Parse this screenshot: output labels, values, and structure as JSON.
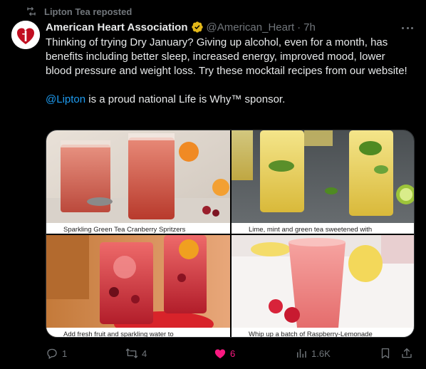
{
  "repost": {
    "text": "Lipton Tea reposted",
    "icon": "repost-icon"
  },
  "author": {
    "name": "American Heart Association",
    "handle": "@American_Heart",
    "separator": "·",
    "time": "7h",
    "verified_color": "#e2b719",
    "avatar_icon": "aha-heart-torch-logo",
    "avatar_color": "#c10e21"
  },
  "tweet": {
    "text": "Thinking of trying Dry January? Giving up alcohol, even for a month, has benefits including better sleep, increased energy, improved mood, lower blood pressure and weight loss. Try these mocktail recipes from our website!",
    "mention": "@Lipton",
    "text2": " is a proud national Life is Why™ sponsor."
  },
  "media": [
    {
      "caption": "Sparkling Green Tea Cranberry Spritzers"
    },
    {
      "caption": "Lime, mint and green tea sweetened with"
    },
    {
      "caption": "Add fresh fruit and sparkling water to"
    },
    {
      "caption": "Whip up a batch of Raspberry-Lemonade"
    }
  ],
  "actions": {
    "replies": "1",
    "reposts": "4",
    "likes": "6",
    "views": "1.6K",
    "like_color": "#f91880",
    "muted_color": "#71767b"
  },
  "colors": {
    "link": "#1d9bf0",
    "background": "#000000",
    "text": "#e7e9ea"
  }
}
